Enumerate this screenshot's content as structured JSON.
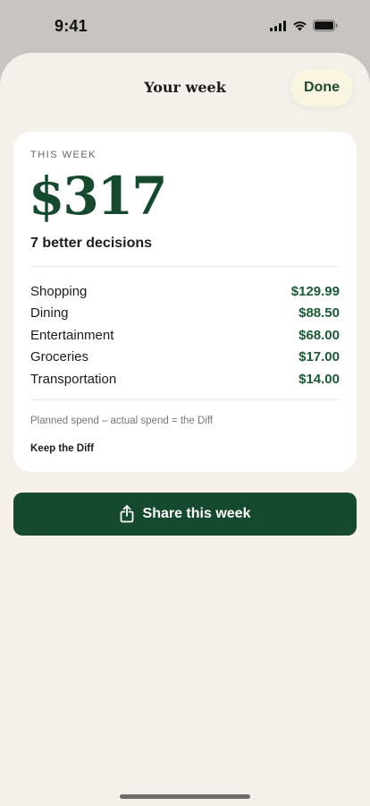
{
  "status_bar": {
    "time": "9:41"
  },
  "sheet": {
    "title": "Your week",
    "done_label": "Done"
  },
  "card": {
    "eyebrow": "THIS WEEK",
    "amount": "$317",
    "subtitle": "7 better decisions",
    "rows": [
      {
        "label": "Shopping",
        "value": "$129.99"
      },
      {
        "label": "Dining",
        "value": "$88.50"
      },
      {
        "label": "Entertainment",
        "value": "$68.00"
      },
      {
        "label": "Groceries",
        "value": "$17.00"
      },
      {
        "label": "Transportation",
        "value": "$14.00"
      }
    ],
    "formula": "Planned spend – actual spend = the Diff",
    "tagline": "Keep the Diff"
  },
  "share": {
    "label": "Share this week",
    "icon": "share-icon"
  },
  "colors": {
    "accent": "#154a2e",
    "sheet_background": "#f5f0e9",
    "done_background": "#f9f5e0"
  }
}
